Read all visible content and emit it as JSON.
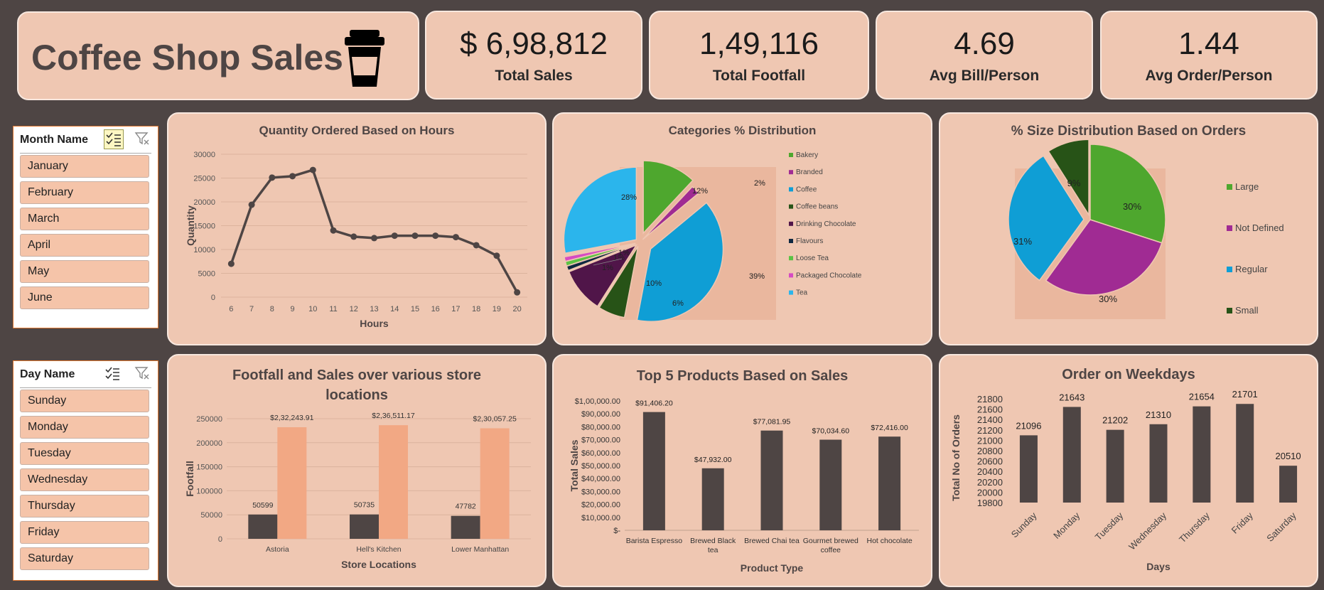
{
  "header": {
    "title": "Coffee Shop Sales",
    "kpis": [
      {
        "value": "$ 6,98,812",
        "label": "Total Sales"
      },
      {
        "value": "1,49,116",
        "label": "Total Footfall"
      },
      {
        "value": "4.69",
        "label": "Avg Bill/Person"
      },
      {
        "value": "1.44",
        "label": "Avg Order/Person"
      }
    ]
  },
  "icons": {
    "title": "coffee-cup-icon",
    "multi_select": "multi-select-icon",
    "clear_filter": "clear-filter-icon"
  },
  "slicers": {
    "month": {
      "title": "Month Name",
      "items": [
        "January",
        "February",
        "March",
        "April",
        "May",
        "June"
      ]
    },
    "day": {
      "title": "Day Name",
      "items": [
        "Sunday",
        "Monday",
        "Tuesday",
        "Wednesday",
        "Thursday",
        "Friday",
        "Saturday"
      ]
    }
  },
  "colors": {
    "background": "#4e4544",
    "card": "#efc7b2",
    "bar_dark": "#4e4544",
    "bar_light": "#f2a884",
    "slicer_item": "#f5c4a9"
  },
  "chart_data": [
    {
      "id": "hours",
      "type": "line",
      "title": "Quantity Ordered Based on Hours",
      "xlabel": "Hours",
      "ylabel": "Quantity",
      "x": [
        6,
        7,
        8,
        9,
        10,
        11,
        12,
        13,
        14,
        15,
        16,
        17,
        18,
        19,
        20
      ],
      "y": [
        7000,
        19400,
        25100,
        25400,
        26700,
        14000,
        12700,
        12400,
        12900,
        12900,
        12900,
        12600,
        10900,
        8700,
        1000
      ],
      "ylim": [
        0,
        30000
      ],
      "yticks": [
        "30000",
        "25000",
        "20000",
        "15000",
        "10000",
        "5000",
        "0"
      ],
      "grid": true,
      "color": "#4e4544"
    },
    {
      "id": "categories",
      "type": "pie",
      "title": "Categories % Distribution",
      "labels": [
        "Bakery",
        "Branded",
        "Coffee",
        "Coffee beans",
        "Drinking Chocolate",
        "Flavours",
        "Loose Tea",
        "Packaged Chocolate",
        "Tea"
      ],
      "values": [
        12,
        2,
        39,
        6,
        10,
        1,
        1,
        1,
        28
      ],
      "value_labels": [
        "12%",
        "2%",
        "39%",
        "6%",
        "10%",
        "1%",
        "1%",
        "1%",
        "28%"
      ],
      "colors": [
        "#4ea72e",
        "#a02b93",
        "#0f9ed5",
        "#275317",
        "#501549",
        "#0e2841",
        "#5bc244",
        "#d64bc3",
        "#2bb5ec"
      ],
      "legend": "right"
    },
    {
      "id": "sizes",
      "type": "pie",
      "title": "% Size Distribution Based on Orders",
      "labels": [
        "Large",
        "Not Defined",
        "Regular",
        "Small"
      ],
      "values": [
        30,
        30,
        31,
        9
      ],
      "value_labels": [
        "30%",
        "30%",
        "31%",
        "9%"
      ],
      "colors": [
        "#4ea72e",
        "#a02b93",
        "#0f9ed5",
        "#275317"
      ],
      "legend": "right"
    },
    {
      "id": "stores",
      "type": "bar",
      "title": "Footfall and Sales over various store locations",
      "title_lines": [
        "Footfall and Sales over various store",
        "locations"
      ],
      "xlabel": "Store Locations",
      "ylabel": "Footfall",
      "categories": [
        "Astoria",
        "Hell's Kitchen",
        "Lower Manhattan"
      ],
      "series": [
        {
          "values": [
            50599,
            50735,
            47782
          ],
          "labels": [
            "50599",
            "50735",
            "47782"
          ],
          "color": "#4e4544"
        },
        {
          "values": [
            232243.91,
            236511.17,
            230057.25
          ],
          "labels": [
            "$2,32,243.91",
            "$2,36,511.17",
            "$2,30,057.25"
          ],
          "color": "#f2a884"
        }
      ],
      "ylim": [
        0,
        250000
      ],
      "yticks": [
        "250000",
        "200000",
        "150000",
        "100000",
        "50000",
        "0"
      ]
    },
    {
      "id": "products",
      "type": "bar",
      "title": "Top 5 Products Based on Sales",
      "xlabel": "Product Type",
      "ylabel": "Total Sales",
      "categories": [
        [
          "Barista Espresso"
        ],
        [
          "Brewed Black",
          "tea"
        ],
        [
          "Brewed Chai tea"
        ],
        [
          "Gourmet brewed",
          "coffee"
        ],
        [
          "Hot chocolate"
        ]
      ],
      "values": [
        91406.2,
        47932.0,
        77081.95,
        70034.6,
        72416.0
      ],
      "value_labels": [
        "$91,406.20",
        "$47,932.00",
        "$77,081.95",
        "$70,034.60",
        "$72,416.00"
      ],
      "ylim": [
        0,
        100000
      ],
      "yticks": [
        "$1,00,000.00",
        "$90,000.00",
        "$80,000.00",
        "$70,000.00",
        "$60,000.00",
        "$50,000.00",
        "$40,000.00",
        "$30,000.00",
        "$20,000.00",
        "$10,000.00",
        "$-"
      ],
      "color": "#4e4544"
    },
    {
      "id": "weekdays",
      "type": "bar",
      "title": "Order on Weekdays",
      "xlabel": "Days",
      "ylabel": "Total No of Orders",
      "categories": [
        "Sunday",
        "Monday",
        "Tuesday",
        "Wednesday",
        "Thursday",
        "Friday",
        "Saturday"
      ],
      "values": [
        21096,
        21643,
        21202,
        21310,
        21654,
        21701,
        20510
      ],
      "value_labels": [
        "21096",
        "21643",
        "21202",
        "21310",
        "21654",
        "21701",
        "20510"
      ],
      "ylim": [
        19800,
        21800
      ],
      "yticks": [
        "21800",
        "21600",
        "21400",
        "21200",
        "21000",
        "20800",
        "20600",
        "20400",
        "20200",
        "20000",
        "19800"
      ],
      "color": "#4e4544"
    }
  ]
}
